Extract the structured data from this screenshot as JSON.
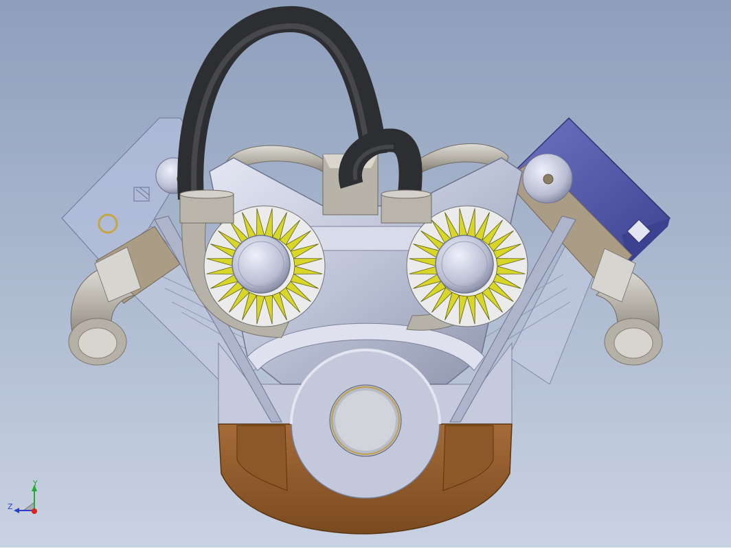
{
  "colors": {
    "background_top": "#8e9fbc",
    "background_bottom": "#c7d0e0",
    "steel": "#c2c7da",
    "steel_dark": "#8d93ab",
    "bronze": "#9a6433",
    "bronze_dark": "#6b3f17",
    "khaki": "#a89a86",
    "hose": "#3c3d41",
    "gear": "#d7d62a",
    "blue_cover": "#555aa6",
    "glass": "#b4bfdc",
    "axis_x": "#e0201a",
    "axis_y": "#1fae2f",
    "axis_z": "#2b3fc8"
  },
  "triad": {
    "y_label": "Y",
    "z_label": "Z"
  }
}
